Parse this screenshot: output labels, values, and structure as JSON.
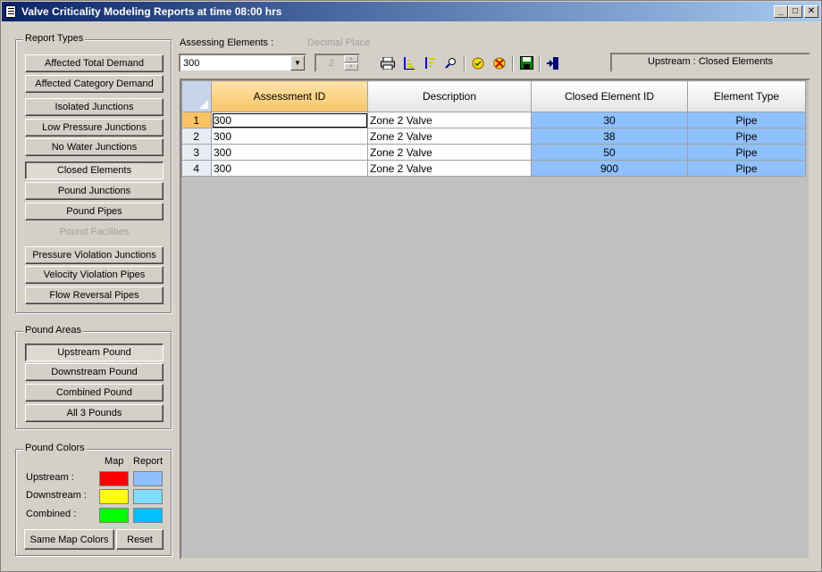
{
  "window": {
    "title": "Valve Criticality Modeling Reports at time 08:00 hrs",
    "controls": {
      "minimize": "_",
      "maximize": "□",
      "close": "✕"
    }
  },
  "report_types": {
    "legend": "Report Types",
    "buttons": [
      {
        "label": "Affected Total Demand",
        "state": "normal"
      },
      {
        "label": "Affected Category Demand",
        "state": "normal"
      },
      {
        "label": "Isolated Junctions",
        "state": "normal"
      },
      {
        "label": "Low Pressure Junctions",
        "state": "normal"
      },
      {
        "label": "No Water Junctions",
        "state": "normal"
      },
      {
        "label": "Closed Elements",
        "state": "pressed"
      },
      {
        "label": "Pound Junctions",
        "state": "normal"
      },
      {
        "label": "Pound Pipes",
        "state": "normal"
      },
      {
        "label": "Pound Facilities",
        "state": "disabled"
      },
      {
        "label": "Pressure Violation Junctions",
        "state": "normal"
      },
      {
        "label": "Velocity Violation Pipes",
        "state": "normal"
      },
      {
        "label": "Flow Reversal Pipes",
        "state": "normal"
      }
    ]
  },
  "pound_areas": {
    "legend": "Pound Areas",
    "buttons": [
      {
        "label": "Upstream Pound",
        "state": "pressed"
      },
      {
        "label": "Downstream Pound",
        "state": "normal"
      },
      {
        "label": "Combined Pound",
        "state": "normal"
      },
      {
        "label": "All 3 Pounds",
        "state": "normal"
      }
    ]
  },
  "pound_colors": {
    "legend": "Pound Colors",
    "col_map": "Map",
    "col_report": "Report",
    "rows": [
      {
        "label": "Upstream :",
        "map_color": "#ff0000",
        "report_color": "#8fc0ff"
      },
      {
        "label": "Downstream :",
        "map_color": "#ffff00",
        "report_color": "#80dcff"
      },
      {
        "label": "Combined :",
        "map_color": "#00ff00",
        "report_color": "#00c0ff"
      }
    ],
    "same_map_colors_label": "Same Map Colors",
    "reset_label": "Reset"
  },
  "toolbar": {
    "assessing_label": "Assessing Elements :",
    "assessing_value": "300",
    "decimal_label": "Decimal Place",
    "decimal_value": "2",
    "status_text": "Upstream : Closed Elements",
    "icons": [
      "printer-icon",
      "sort-ascending-icon",
      "sort-descending-icon",
      "find-icon",
      "highlight-icon",
      "clear-highlight-icon",
      "save-icon",
      "exit-icon"
    ]
  },
  "grid": {
    "columns": [
      "Assessment ID",
      "Description",
      "Closed Element ID",
      "Element Type"
    ],
    "rows": [
      {
        "num": "1",
        "assessment_id": "300",
        "description": "Zone 2  Valve",
        "closed_element_id": "30",
        "element_type": "Pipe"
      },
      {
        "num": "2",
        "assessment_id": "300",
        "description": "Zone 2  Valve",
        "closed_element_id": "38",
        "element_type": "Pipe"
      },
      {
        "num": "3",
        "assessment_id": "300",
        "description": "Zone 2  Valve",
        "closed_element_id": "50",
        "element_type": "Pipe"
      },
      {
        "num": "4",
        "assessment_id": "300",
        "description": "Zone 2  Valve",
        "closed_element_id": "900",
        "element_type": "Pipe"
      }
    ],
    "highlight_color": "#8fc0ff",
    "active_header_color": "#f8c466"
  }
}
